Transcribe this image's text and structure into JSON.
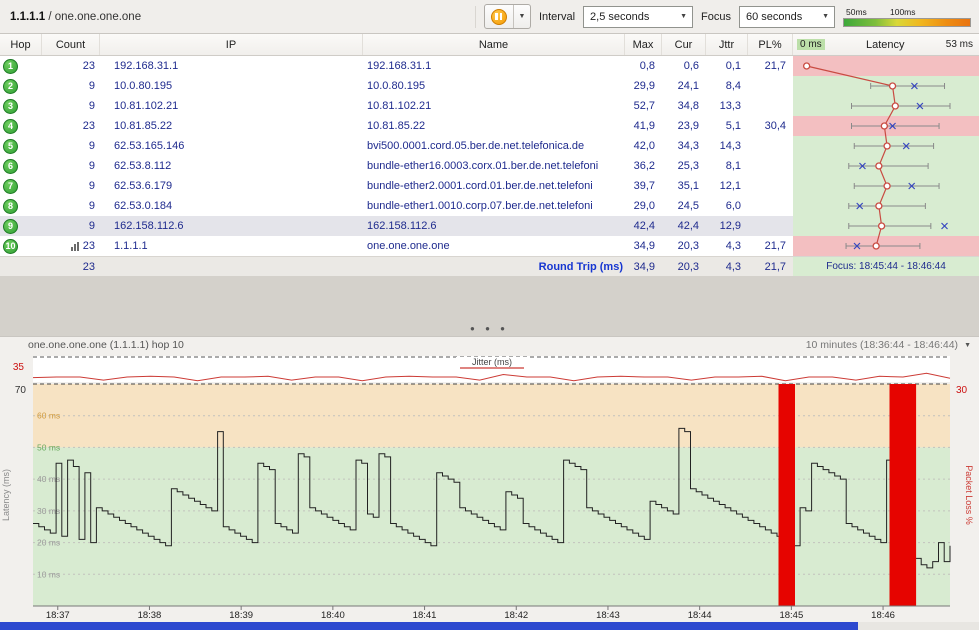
{
  "toolbar": {
    "target_bold": "1.1.1.1",
    "target_rest": " / one.one.one.one",
    "interval_label": "Interval",
    "interval_value": "2,5 seconds",
    "focus_label": "Focus",
    "focus_value": "60 seconds",
    "legend_50": "50ms",
    "legend_100": "100ms"
  },
  "splitter": {
    "dots": "● ● ●"
  },
  "table": {
    "headers": {
      "hop": "Hop",
      "count": "Count",
      "ip": "IP",
      "name": "Name",
      "max": "Max",
      "cur": "Cur",
      "jttr": "Jttr",
      "pl": "PL%",
      "latency": "Latency",
      "lat_min": "0 ms",
      "lat_max": "53 ms"
    },
    "rows": [
      {
        "hop": "1",
        "count": "23",
        "ip": "192.168.31.1",
        "name": "192.168.31.1",
        "max": "0,8",
        "cur": "0,6",
        "jttr": "0,1",
        "pl": "21,7",
        "loss": true,
        "selected": false,
        "focus_icon": false
      },
      {
        "hop": "2",
        "count": "9",
        "ip": "10.0.80.195",
        "name": "10.0.80.195",
        "max": "29,9",
        "cur": "24,1",
        "jttr": "8,4",
        "pl": "",
        "loss": false,
        "selected": false,
        "focus_icon": false
      },
      {
        "hop": "3",
        "count": "9",
        "ip": "10.81.102.21",
        "name": "10.81.102.21",
        "max": "52,7",
        "cur": "34,8",
        "jttr": "13,3",
        "pl": "",
        "loss": false,
        "selected": false,
        "focus_icon": false
      },
      {
        "hop": "4",
        "count": "23",
        "ip": "10.81.85.22",
        "name": "10.81.85.22",
        "max": "41,9",
        "cur": "23,9",
        "jttr": "5,1",
        "pl": "30,4",
        "loss": true,
        "selected": false,
        "focus_icon": false
      },
      {
        "hop": "5",
        "count": "9",
        "ip": "62.53.165.146",
        "name": "bvi500.0001.cord.05.ber.de.net.telefonica.de",
        "max": "42,0",
        "cur": "34,3",
        "jttr": "14,3",
        "pl": "",
        "loss": false,
        "selected": false,
        "focus_icon": false
      },
      {
        "hop": "6",
        "count": "9",
        "ip": "62.53.8.112",
        "name": "bundle-ether16.0003.corx.01.ber.de.net.telefoni",
        "max": "36,2",
        "cur": "25,3",
        "jttr": "8,1",
        "pl": "",
        "loss": false,
        "selected": false,
        "focus_icon": false
      },
      {
        "hop": "7",
        "count": "9",
        "ip": "62.53.6.179",
        "name": "bundle-ether2.0001.cord.01.ber.de.net.telefoni",
        "max": "39,7",
        "cur": "35,1",
        "jttr": "12,1",
        "pl": "",
        "loss": false,
        "selected": false,
        "focus_icon": false
      },
      {
        "hop": "8",
        "count": "9",
        "ip": "62.53.0.184",
        "name": "bundle-ether1.0010.corp.07.ber.de.net.telefoni",
        "max": "29,0",
        "cur": "24,5",
        "jttr": "6,0",
        "pl": "",
        "loss": false,
        "selected": false,
        "focus_icon": false
      },
      {
        "hop": "9",
        "count": "9",
        "ip": "162.158.112.6",
        "name": "162.158.112.6",
        "max": "42,4",
        "cur": "42,4",
        "jttr": "12,9",
        "pl": "",
        "loss": false,
        "selected": true,
        "focus_icon": false
      },
      {
        "hop": "10",
        "count": "23",
        "ip": "1.1.1.1",
        "name": "one.one.one.one",
        "max": "34,9",
        "cur": "20,3",
        "jttr": "4,3",
        "pl": "21,7",
        "loss": true,
        "selected": false,
        "focus_icon": true
      }
    ],
    "footer": {
      "count": "23",
      "label": "Round Trip (ms)",
      "max": "34,9",
      "cur": "20,3",
      "jttr": "4,3",
      "pl": "21,7",
      "focus": "Focus: 18:45:44 - 18:46:44"
    }
  },
  "chart_data": [
    {
      "type": "scatter",
      "title": "Per-hop latency distribution (ms)",
      "xlim": [
        0,
        53
      ],
      "x_axis_label_min": "0 ms",
      "x_axis_label_max": "53 ms",
      "hops": [
        {
          "hop": 1,
          "cur": 0.6,
          "avg_x": null,
          "min": null,
          "max": null,
          "loss": true
        },
        {
          "hop": 2,
          "cur": 32,
          "avg_x": 40,
          "min": 24,
          "max": 51,
          "loss": false
        },
        {
          "hop": 3,
          "cur": 33,
          "avg_x": 42,
          "min": 17,
          "max": 53,
          "loss": false
        },
        {
          "hop": 4,
          "cur": 29,
          "avg_x": 32,
          "min": 17,
          "max": 49,
          "loss": true
        },
        {
          "hop": 5,
          "cur": 30,
          "avg_x": 37,
          "min": 18,
          "max": 47,
          "loss": false
        },
        {
          "hop": 6,
          "cur": 27,
          "avg_x": 21,
          "min": 16,
          "max": 45,
          "loss": false
        },
        {
          "hop": 7,
          "cur": 30,
          "avg_x": 39,
          "min": 18,
          "max": 49,
          "loss": false
        },
        {
          "hop": 8,
          "cur": 27,
          "avg_x": 20,
          "min": 16,
          "max": 44,
          "loss": false
        },
        {
          "hop": 9,
          "cur": 28,
          "avg_x": 51,
          "min": 16,
          "max": 46,
          "loss": false
        },
        {
          "hop": 10,
          "cur": 26,
          "avg_x": 19,
          "min": 15,
          "max": 42,
          "loss": true
        }
      ]
    },
    {
      "type": "line",
      "title": "one.one.one.one (1.1.1.1) hop 10",
      "range_label": "10 minutes (18:36:44 - 18:46:44)",
      "ylabel": "Latency (ms)",
      "ylabel_right": "Packet Loss %",
      "ylim": [
        0,
        70
      ],
      "y_axis_top_label": "70",
      "right_axis_top_label": "30",
      "jitter_label": "Jitter (ms)",
      "jitter_axis_label": "35",
      "jitter_ylim": [
        0,
        35
      ],
      "green_zone_max": 50,
      "gridlines_ms": [
        10,
        20,
        30,
        40,
        50,
        60
      ],
      "unit_suffix": " ms",
      "x_ticks": [
        "18:37",
        "18:38",
        "18:39",
        "18:40",
        "18:41",
        "18:42",
        "18:43",
        "18:44",
        "18:45",
        "18:46"
      ],
      "x_tick_fracs": [
        0.027,
        0.127,
        0.227,
        0.327,
        0.427,
        0.527,
        0.627,
        0.727,
        0.827,
        0.927
      ],
      "latency_values": [
        26,
        25,
        24,
        23,
        45,
        22,
        46,
        44,
        21,
        42,
        20,
        31,
        30,
        29,
        28,
        27,
        26,
        25,
        24,
        23,
        22,
        21,
        20,
        19,
        37,
        36,
        35,
        34,
        33,
        32,
        31,
        30,
        55,
        25,
        24,
        23,
        22,
        21,
        20,
        45,
        44,
        43,
        26,
        25,
        24,
        23,
        48,
        47,
        31,
        30,
        29,
        28,
        27,
        26,
        25,
        24,
        46,
        45,
        29,
        28,
        48,
        47,
        26,
        25,
        24,
        23,
        22,
        21,
        20,
        19,
        42,
        41,
        40,
        39,
        31,
        30,
        29,
        28,
        27,
        26,
        25,
        24,
        36,
        35,
        34,
        26,
        25,
        24,
        23,
        22,
        21,
        20,
        46,
        45,
        44,
        43,
        31,
        30,
        29,
        28,
        27,
        26,
        25,
        24,
        23,
        22,
        21,
        33,
        32,
        31,
        30,
        29,
        56,
        55,
        37,
        36,
        35,
        34,
        33,
        32,
        31,
        30,
        29,
        28,
        27,
        26,
        25,
        24,
        23,
        22,
        21,
        20,
        19,
        31,
        30,
        45,
        44,
        43,
        42,
        41,
        40,
        26,
        25,
        24,
        23,
        22,
        21,
        20,
        46,
        45,
        44,
        30,
        29,
        15,
        13,
        12,
        14,
        20,
        14,
        19
      ],
      "jitter_values": [
        7,
        8,
        8,
        3,
        8,
        9,
        8,
        2,
        8,
        8,
        9,
        3,
        8,
        8,
        2,
        8,
        9,
        8,
        8,
        3,
        12,
        8,
        8,
        2,
        8,
        9,
        8,
        8,
        3,
        8,
        8,
        9,
        2,
        8,
        8,
        3,
        9,
        8,
        14,
        6
      ],
      "loss_bars_frac": [
        [
          0.813,
          0.831
        ],
        [
          0.934,
          0.963
        ]
      ],
      "focus_end_frac": 0.9,
      "colors": {
        "green_zone": "#d8ebd1",
        "warn_zone": "#f7e3c3",
        "loss_bar": "#e60400",
        "trace": "#222222",
        "jitter": "#cc3b35",
        "focus_bar": "#2d49cf",
        "grid_label_60": "#cf9a3e",
        "grid_label_50": "#6aa85c",
        "grid_label": "#999999"
      }
    }
  ]
}
